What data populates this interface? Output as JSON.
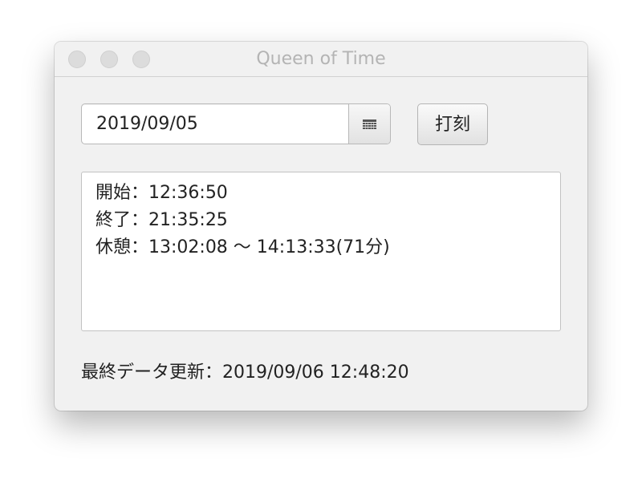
{
  "window": {
    "title": "Queen of Time"
  },
  "date_picker": {
    "value": "2019/09/05",
    "icon": "calendar-icon"
  },
  "stamp_button": {
    "label": "打刻"
  },
  "log": {
    "lines": [
      "開始：12:36:50",
      "終了：21:35:25",
      "休憩：13:02:08 〜 14:13:33(71分)"
    ]
  },
  "status": {
    "last_update": "最終データ更新：2019/09/06 12:48:20"
  }
}
